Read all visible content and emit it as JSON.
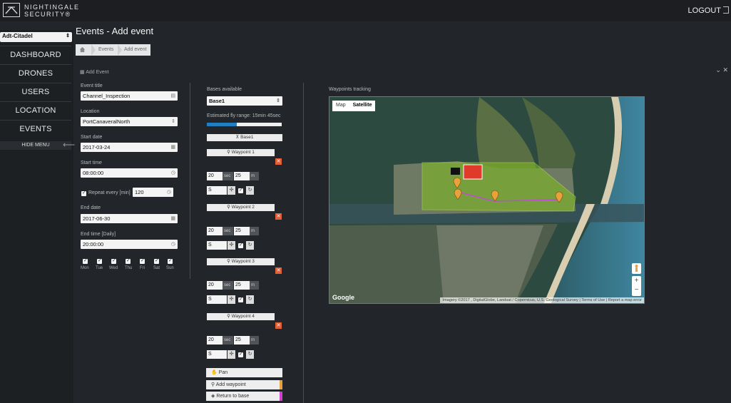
{
  "brand": {
    "line1": "NIGHTINGALE",
    "line2": "SECURITY®"
  },
  "header": {
    "logout_label": "LOGOUT"
  },
  "sidebar": {
    "site": "Adt-Citadel",
    "items": [
      {
        "label": "DASHBOARD"
      },
      {
        "label": "DRONES"
      },
      {
        "label": "USERS"
      },
      {
        "label": "LOCATION"
      },
      {
        "label": "EVENTS"
      }
    ],
    "hide_label": "HIDE MENU"
  },
  "page": {
    "title": "Events - Add event",
    "breadcrumb": [
      "Events",
      "Add event"
    ],
    "panel_title": "Add Event"
  },
  "form": {
    "event_title_label": "Event title",
    "event_title_value": "Channel_Inspection",
    "location_label": "Location",
    "location_value": "PortCanaveralNorth",
    "start_date_label": "Start date",
    "start_date_value": "2017-03-24",
    "start_time_label": "Start time",
    "start_time_value": "08:00:00",
    "repeat_label": "Repeat every [min]",
    "repeat_value": "120",
    "end_date_label": "End date",
    "end_date_value": "2017-06-30",
    "end_time_label": "End time [Daily]",
    "end_time_value": "20:00:00",
    "days": [
      "Mon",
      "Tue",
      "Wed",
      "Thu",
      "Fri",
      "Sat",
      "Sun"
    ]
  },
  "bases": {
    "label": "Bases available",
    "selected": "Base1",
    "range_label": "Estimated fly range: 15min 45sec",
    "range_fraction": 0.4,
    "base_button": "Base1",
    "sec_unit": "sec",
    "m_unit": "m",
    "waypoints": [
      {
        "label": "Waypoint 1",
        "sec": "20",
        "m": "25",
        "dir": "S"
      },
      {
        "label": "Waypoint 2",
        "sec": "20",
        "m": "25",
        "dir": "S"
      },
      {
        "label": "Waypoint 3",
        "sec": "20",
        "m": "25",
        "dir": "S"
      },
      {
        "label": "Waypoint 4",
        "sec": "20",
        "m": "25",
        "dir": "S"
      }
    ],
    "tools": [
      {
        "label": "Pan",
        "color": "#eeeeee"
      },
      {
        "label": "Add waypoint",
        "color": "#e9a23b"
      },
      {
        "label": "Return to base",
        "color": "#d43fd1"
      }
    ]
  },
  "map": {
    "label": "Waypoints tracking",
    "toggle": [
      "Map",
      "Satellite"
    ],
    "active_toggle": "Satellite",
    "provider": "Google",
    "attribution": "Imagery ©2017 , DigitalGlobe, Landsat / Copernicus, U.S. Geological Survey | Terms of Use | Report a map error",
    "colors": {
      "zone": "#7fbf1e",
      "route": "#c04bd6",
      "pin": "#e9a23b",
      "base_marker": "#e03a2a"
    }
  }
}
